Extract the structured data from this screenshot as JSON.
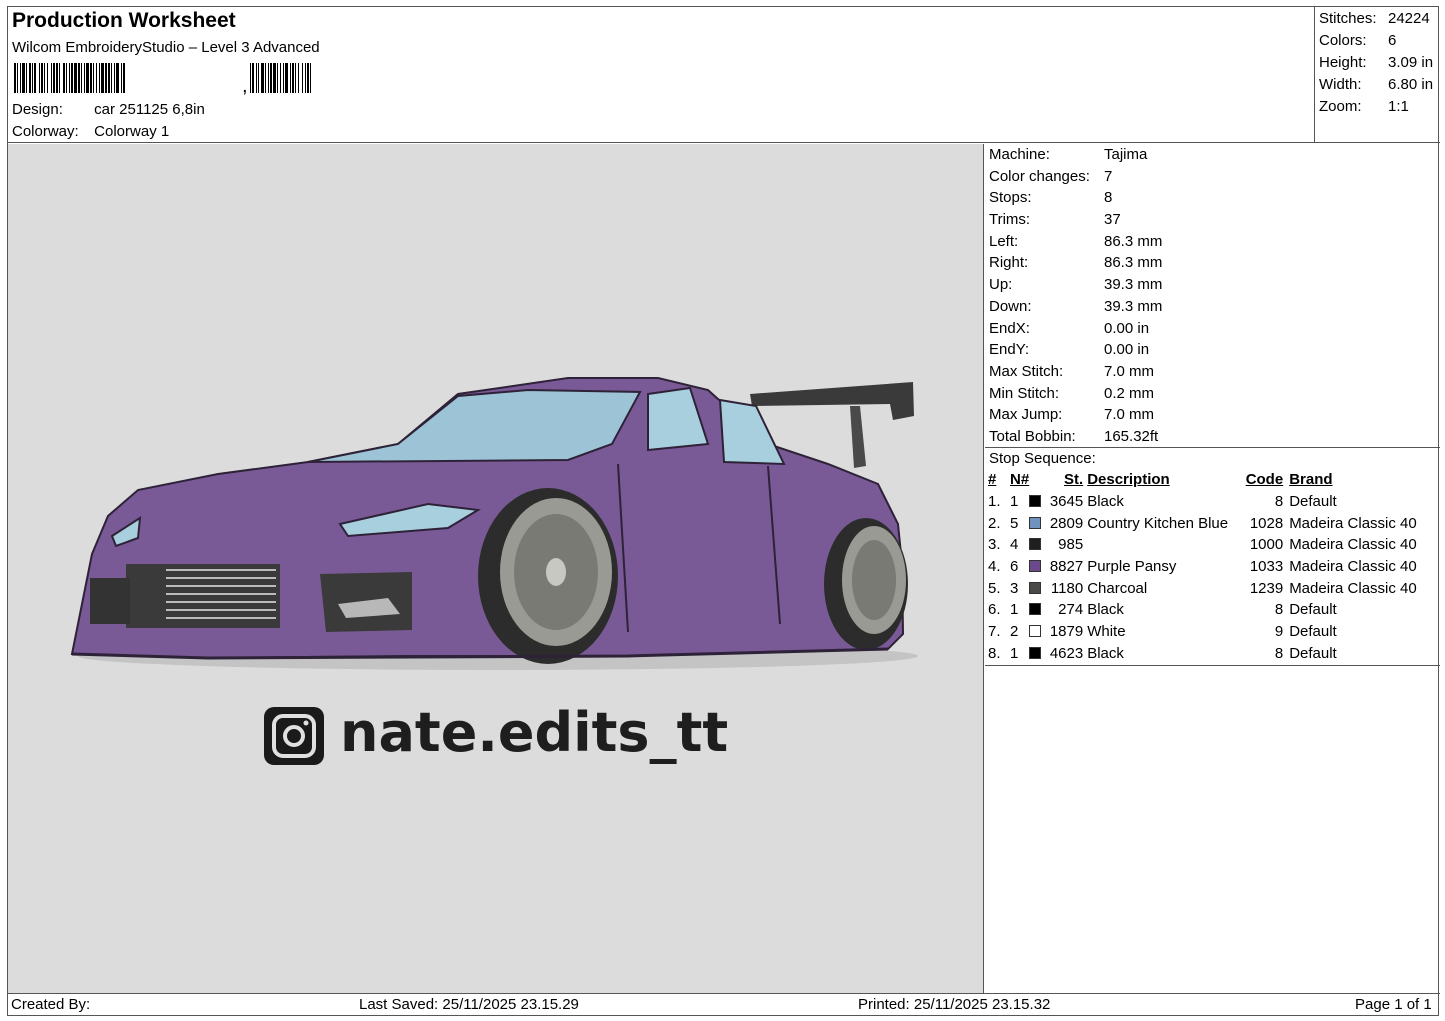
{
  "header": {
    "title": "Production Worksheet",
    "subtitle": "Wilcom EmbroideryStudio – Level 3 Advanced",
    "barcode_suffix": ",",
    "design_label": "Design:",
    "design_value": "car 251125 6,8in",
    "colorway_label": "Colorway:",
    "colorway_value": "Colorway 1"
  },
  "stats": [
    {
      "label": "Stitches:",
      "value": "24224"
    },
    {
      "label": "Colors:",
      "value": "6"
    },
    {
      "label": "Height:",
      "value": "3.09 in"
    },
    {
      "label": "Width:",
      "value": "6.80 in"
    },
    {
      "label": "Zoom:",
      "value": "1:1"
    }
  ],
  "machine_info": [
    {
      "label": "Machine:",
      "value": "Tajima"
    },
    {
      "label": "Color changes:",
      "value": "7"
    },
    {
      "label": "Stops:",
      "value": "8"
    },
    {
      "label": "Trims:",
      "value": "37"
    },
    {
      "label": "Left:",
      "value": "86.3 mm"
    },
    {
      "label": "Right:",
      "value": "86.3 mm"
    },
    {
      "label": "Up:",
      "value": "39.3 mm"
    },
    {
      "label": "Down:",
      "value": "39.3 mm"
    },
    {
      "label": "EndX:",
      "value": "0.00 in"
    },
    {
      "label": "EndY:",
      "value": "0.00 in"
    },
    {
      "label": "Max Stitch:",
      "value": "7.0 mm"
    },
    {
      "label": "Min Stitch:",
      "value": "0.2 mm"
    },
    {
      "label": "Max Jump:",
      "value": "7.0 mm"
    },
    {
      "label": "Total Bobbin:",
      "value": "165.32ft"
    }
  ],
  "stop_sequence": {
    "title": "Stop Sequence:",
    "headers": {
      "idx": "#",
      "n": "N#",
      "st": "St.",
      "desc": "Description",
      "code": "Code",
      "brand": "Brand"
    },
    "rows": [
      {
        "idx": "1.",
        "n": "1",
        "color": "#000000",
        "st": "3645",
        "desc": "Black",
        "code": "8",
        "brand": "Default"
      },
      {
        "idx": "2.",
        "n": "5",
        "color": "#6f93bd",
        "st": "2809",
        "desc": "Country Kitchen Blue",
        "code": "1028",
        "brand": "Madeira Classic 40"
      },
      {
        "idx": "3.",
        "n": "4",
        "color": "#1f1f1f",
        "st": "985",
        "desc": "",
        "code": "1000",
        "brand": "Madeira Classic 40"
      },
      {
        "idx": "4.",
        "n": "6",
        "color": "#6b4a8c",
        "st": "8827",
        "desc": "Purple Pansy",
        "code": "1033",
        "brand": "Madeira Classic 40"
      },
      {
        "idx": "5.",
        "n": "3",
        "color": "#4a4a48",
        "st": "1180",
        "desc": "Charcoal",
        "code": "1239",
        "brand": "Madeira Classic 40"
      },
      {
        "idx": "6.",
        "n": "1",
        "color": "#000000",
        "st": "274",
        "desc": "Black",
        "code": "8",
        "brand": "Default"
      },
      {
        "idx": "7.",
        "n": "2",
        "color": "#ffffff",
        "st": "1879",
        "desc": "White",
        "code": "9",
        "brand": "Default"
      },
      {
        "idx": "8.",
        "n": "1",
        "color": "#000000",
        "st": "4623",
        "desc": "Black",
        "code": "8",
        "brand": "Default"
      }
    ]
  },
  "design_preview": {
    "handle_text": "nate.edits_tt",
    "icon": "instagram-icon"
  },
  "footer": {
    "created_by": "Created By:",
    "last_saved": "Last Saved: 25/11/2025 23.15.29",
    "printed": "Printed: 25/11/2025 23.15.32",
    "page": "Page 1 of 1"
  }
}
